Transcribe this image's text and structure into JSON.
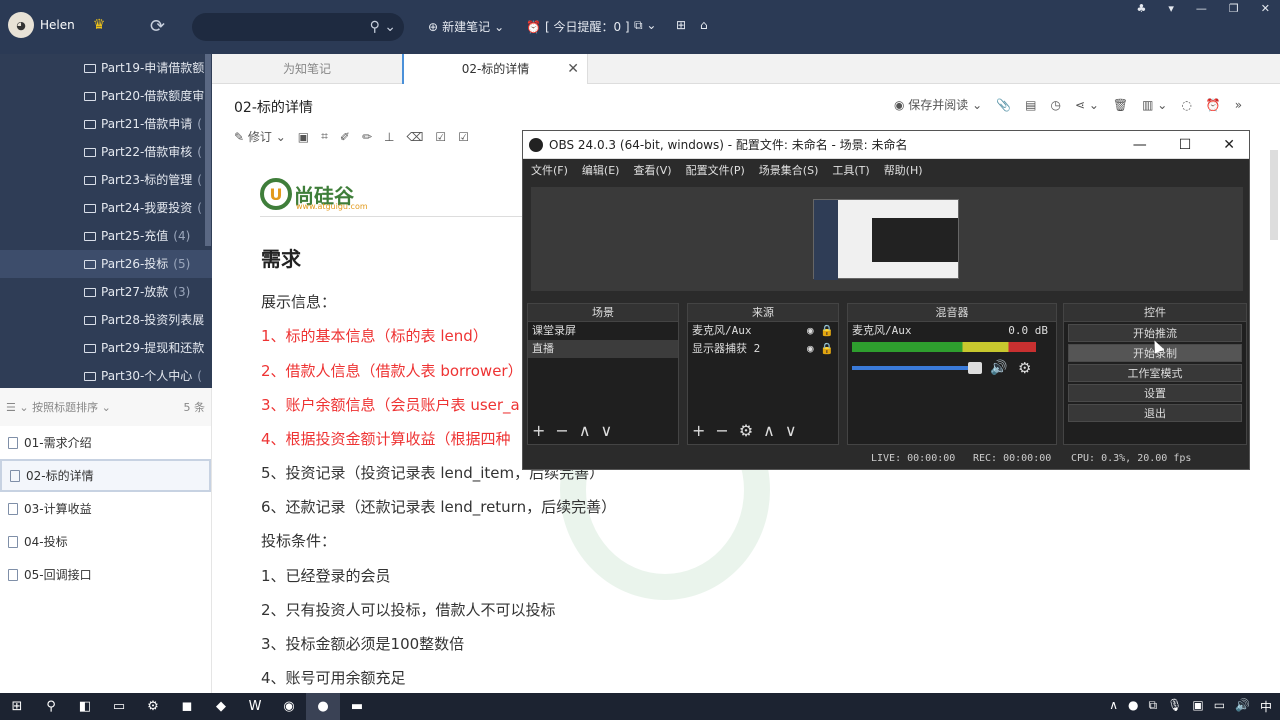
{
  "app": {
    "user_name": "Helen",
    "new_note": "新建笔记",
    "reminder": "[ 今日提醒：0 ]"
  },
  "sidebar": {
    "items": [
      {
        "label": "Part19-申请借款额",
        "count": ""
      },
      {
        "label": "Part20-借款额度审",
        "count": ""
      },
      {
        "label": "Part21-借款申请",
        "count": "("
      },
      {
        "label": "Part22-借款审核",
        "count": "("
      },
      {
        "label": "Part23-标的管理",
        "count": "("
      },
      {
        "label": "Part24-我要投资",
        "count": "("
      },
      {
        "label": "Part25-充值",
        "count": "(4)"
      },
      {
        "label": "Part26-投标",
        "count": "(5)"
      },
      {
        "label": "Part27-放款",
        "count": "(3)"
      },
      {
        "label": "Part28-投资列表展",
        "count": ""
      },
      {
        "label": "Part29-提现和还款",
        "count": ""
      },
      {
        "label": "Part30-个人中心",
        "count": "("
      }
    ]
  },
  "notelist": {
    "sort_label": "按照标题排序",
    "count": "5 条",
    "notes": [
      "01-需求介绍",
      "02-标的详情",
      "03-计算收益",
      "04-投标",
      "05-回调接口"
    ]
  },
  "tabs": {
    "tab1": "为知笔记",
    "tab2": "02-标的详情"
  },
  "note": {
    "title": "02-标的详情",
    "save_read": "保存并阅读",
    "revise": "修订",
    "logo_text": "尚硅谷",
    "logo_sub": "www.atguigu.com",
    "heading": "需求",
    "lines": [
      "展示信息：",
      "1、标的基本信息（标的表 lend）",
      "2、借款人信息（借款人表 borrower）",
      "3、账户余额信息（会员账户表 user_a",
      "4、根据投资金额计算收益（根据四种",
      "5、投资记录（投资记录表 lend_item，后续完善）",
      "6、还款记录（还款记录表 lend_return，后续完善）",
      "投标条件：",
      "1、已经登录的会员",
      "2、只有投资人可以投标，借款人不可以投标",
      "3、投标金额必须是100整数倍",
      "4、账号可用余额充足"
    ]
  },
  "obs": {
    "title": "OBS 24.0.3 (64-bit, windows) - 配置文件: 未命名 - 场景: 未命名",
    "menu": [
      "文件(F)",
      "编辑(E)",
      "查看(V)",
      "配置文件(P)",
      "场景集合(S)",
      "工具(T)",
      "帮助(H)"
    ],
    "scenes_header": "场景",
    "scenes": [
      "课堂录屏",
      "直播"
    ],
    "sources_header": "来源",
    "sources": [
      "麦克风/Aux",
      "显示器捕获 2"
    ],
    "mixer_header": "混音器",
    "mixer_channel": "麦克风/Aux",
    "mixer_db": "0.0 dB",
    "controls_header": "控件",
    "controls": [
      "开始推流",
      "开始录制",
      "工作室模式",
      "设置",
      "退出"
    ],
    "status_live": "LIVE: 00:00:00",
    "status_rec": "REC: 00:00:00",
    "status_cpu": "CPU: 0.3%, 20.00 fps"
  },
  "taskbar": {
    "lang": "中"
  }
}
